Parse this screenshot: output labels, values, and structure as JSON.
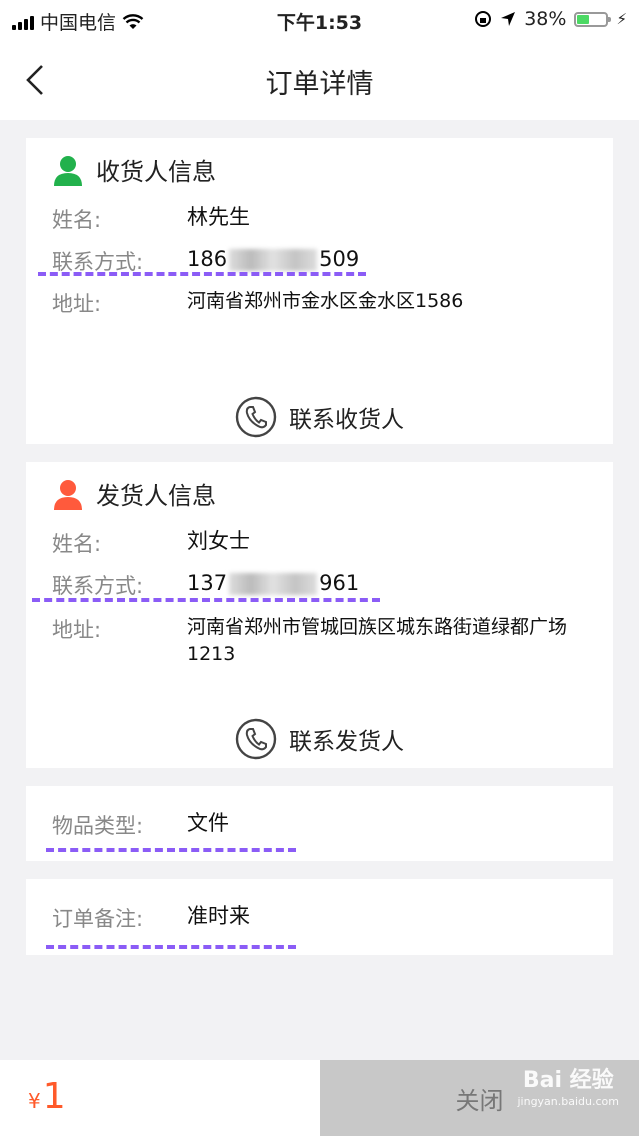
{
  "status_bar": {
    "carrier": "中国电信",
    "time": "下午1:53",
    "battery_percent": "38%",
    "battery_level": 0.38
  },
  "nav": {
    "title": "订单详情"
  },
  "receiver": {
    "header": "收货人信息",
    "name_label": "姓名:",
    "name": "林先生",
    "phone_label": "联系方式:",
    "phone_prefix": "186",
    "phone_suffix": "509",
    "address_label": "地址:",
    "address": "河南省郑州市金水区金水区1586",
    "contact_button": "联系收货人"
  },
  "sender": {
    "header": "发货人信息",
    "name_label": "姓名:",
    "name": "刘女士",
    "phone_label": "联系方式:",
    "phone_prefix": "137",
    "phone_suffix": "961",
    "address_label": "地址:",
    "address": "河南省郑州市管城回族区城东路街道绿都广场1213",
    "contact_button": "联系发货人"
  },
  "item": {
    "label": "物品类型:",
    "value": "文件"
  },
  "remark": {
    "label": "订单备注:",
    "value": "准时来"
  },
  "footer": {
    "currency": "¥",
    "price": "1",
    "close_button": "关闭",
    "watermark": "Bai 经验",
    "watermark_url": "jingyan.baidu.com"
  },
  "colors": {
    "receiver_icon": "#22b14c",
    "sender_icon": "#ff5a3c",
    "price": "#ff5a2a",
    "annotation": "#8b5cf6"
  }
}
